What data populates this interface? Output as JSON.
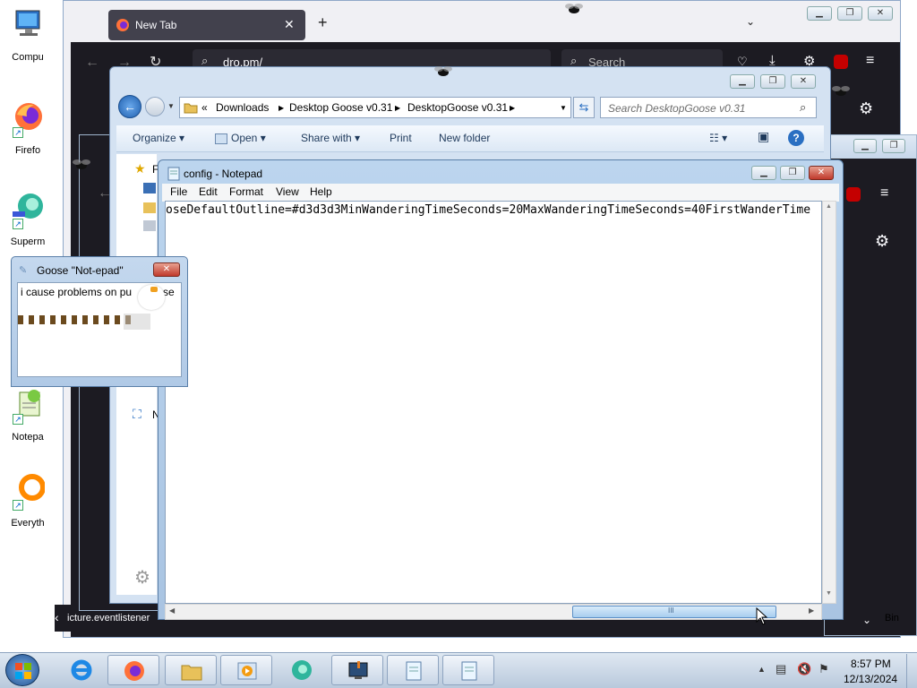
{
  "desktop": {
    "icons": [
      {
        "label": "Compu",
        "icon": "computer-icon"
      },
      {
        "label": "Firefo",
        "icon": "firefox-icon"
      },
      {
        "label": "Superm",
        "icon": "supermium-icon"
      },
      {
        "label": "Notepa",
        "icon": "notepad-plus-icon"
      },
      {
        "label": "Everyth",
        "icon": "everything-icon"
      }
    ],
    "recycle_bin_label": "Bin"
  },
  "firefox": {
    "tab_title": "New Tab",
    "url_text": "dro.pm/",
    "search_placeholder": "Search",
    "status_url": "icture.eventlistener"
  },
  "explorer": {
    "breadcrumb_prefix": "«",
    "breadcrumbs": [
      "Downloads",
      "Desktop Goose v0.31",
      "DesktopGoose v0.31"
    ],
    "search_placeholder": "Search DesktopGoose v0.31",
    "commands": [
      "Organize",
      "Open",
      "Share with",
      "Print",
      "New folder"
    ],
    "nav_item_first_letter": "F",
    "nav_item_network_letter": "N"
  },
  "notepad": {
    "title": "config - Notepad",
    "menu": [
      "File",
      "Edit",
      "Format",
      "View",
      "Help"
    ],
    "content": "oseDefaultOutline=#d3d3d3MinWanderingTimeSeconds=20MaxWanderingTimeSeconds=40FirstWanderTime",
    "scroll_thumb_glyph": "III"
  },
  "goose_notepad": {
    "title": "Goose \"Not-epad\"",
    "text": "i cause problems on pu",
    "text_tail": "se"
  },
  "taskbar": {
    "time": "8:57 PM",
    "date": "12/13/2024",
    "buttons": [
      "start-orb",
      "internet-explorer-icon",
      "firefox-icon",
      "explorer-icon",
      "media-player-icon",
      "supermium-icon",
      "monitor-app-icon",
      "notepad-icon",
      "notepad-icon"
    ]
  },
  "colors": {
    "firefox_dark": "#1c1b22",
    "accent_blue": "#3a7bd5",
    "goose_trail": "#6b4a1e"
  }
}
